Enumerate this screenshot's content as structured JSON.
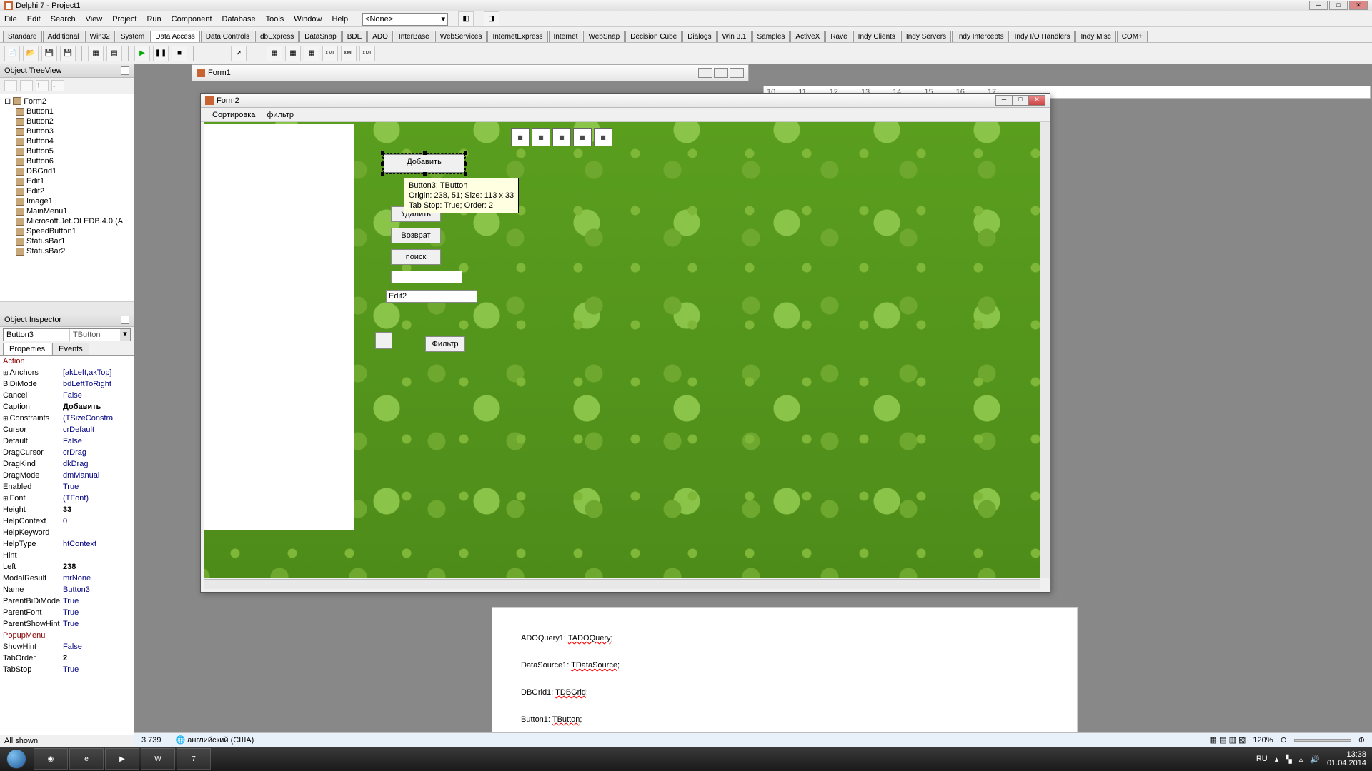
{
  "window_title": "Delphi 7 - Project1",
  "menu": [
    "File",
    "Edit",
    "Search",
    "View",
    "Project",
    "Run",
    "Component",
    "Database",
    "Tools",
    "Window",
    "Help"
  ],
  "menu_combo": "<None>",
  "palette_tabs": [
    "Standard",
    "Additional",
    "Win32",
    "System",
    "Data Access",
    "Data Controls",
    "dbExpress",
    "DataSnap",
    "BDE",
    "ADO",
    "InterBase",
    "WebServices",
    "InternetExpress",
    "Internet",
    "WebSnap",
    "Decision Cube",
    "Dialogs",
    "Win 3.1",
    "Samples",
    "ActiveX",
    "Rave",
    "Indy Clients",
    "Indy Servers",
    "Indy Intercepts",
    "Indy I/O Handlers",
    "Indy Misc",
    "COM+"
  ],
  "active_palette_tab": "Data Access",
  "tree_title": "Object TreeView",
  "tree_root": "Form2",
  "tree_nodes": [
    "Button1",
    "Button2",
    "Button3",
    "Button4",
    "Button5",
    "Button6",
    "DBGrid1",
    "Edit1",
    "Edit2",
    "Image1",
    "MainMenu1",
    "Microsoft.Jet.OLEDB.4.0 (A",
    "SpeedButton1",
    "StatusBar1",
    "StatusBar2"
  ],
  "inspector_title": "Object Inspector",
  "inspector_obj_name": "Button3",
  "inspector_obj_type": "TButton",
  "inspector_tabs": [
    "Properties",
    "Events"
  ],
  "props": [
    {
      "n": "Action",
      "v": "",
      "c": "r"
    },
    {
      "n": "Anchors",
      "v": "[akLeft,akTop]",
      "c": "b",
      "e": true
    },
    {
      "n": "BiDiMode",
      "v": "bdLeftToRight",
      "c": "b"
    },
    {
      "n": "Cancel",
      "v": "False",
      "c": "b"
    },
    {
      "n": "Caption",
      "v": "Добавить",
      "c": "k",
      "bold": true
    },
    {
      "n": "Constraints",
      "v": "(TSizeConstra",
      "c": "b",
      "e": true
    },
    {
      "n": "Cursor",
      "v": "crDefault",
      "c": "b"
    },
    {
      "n": "Default",
      "v": "False",
      "c": "b"
    },
    {
      "n": "DragCursor",
      "v": "crDrag",
      "c": "b"
    },
    {
      "n": "DragKind",
      "v": "dkDrag",
      "c": "b"
    },
    {
      "n": "DragMode",
      "v": "dmManual",
      "c": "b"
    },
    {
      "n": "Enabled",
      "v": "True",
      "c": "b"
    },
    {
      "n": "Font",
      "v": "(TFont)",
      "c": "b",
      "e": true
    },
    {
      "n": "Height",
      "v": "33",
      "c": "k",
      "bold": true
    },
    {
      "n": "HelpContext",
      "v": "0",
      "c": "b"
    },
    {
      "n": "HelpKeyword",
      "v": "",
      "c": "b"
    },
    {
      "n": "HelpType",
      "v": "htContext",
      "c": "b"
    },
    {
      "n": "Hint",
      "v": "",
      "c": "b"
    },
    {
      "n": "Left",
      "v": "238",
      "c": "k",
      "bold": true
    },
    {
      "n": "ModalResult",
      "v": "mrNone",
      "c": "b"
    },
    {
      "n": "Name",
      "v": "Button3",
      "c": "b"
    },
    {
      "n": "ParentBiDiMode",
      "v": "True",
      "c": "b"
    },
    {
      "n": "ParentFont",
      "v": "True",
      "c": "b"
    },
    {
      "n": "ParentShowHint",
      "v": "True",
      "c": "b"
    },
    {
      "n": "PopupMenu",
      "v": "",
      "c": "r"
    },
    {
      "n": "ShowHint",
      "v": "False",
      "c": "b"
    },
    {
      "n": "TabOrder",
      "v": "2",
      "c": "k",
      "bold": true
    },
    {
      "n": "TabStop",
      "v": "True",
      "c": "b"
    }
  ],
  "inspector_status": "All shown",
  "form1_title": "Form1",
  "form2_title": "Form2",
  "form2_menu": [
    "Сортировка",
    "фильтр"
  ],
  "buttons": {
    "add": "Добавить",
    "delete": "Удалить",
    "return": "Возврат",
    "search": "поиск",
    "filter": "Фильтр"
  },
  "edit2_text": "Edit2",
  "tooltip_lines": [
    "Button3: TButton",
    "Origin: 238, 51; Size: 113 x 33",
    "Tab Stop: True; Order: 2"
  ],
  "doc_lines": [
    {
      "a": "ADOQuery1: ",
      "b": "TADOQuery",
      ";": ";"
    },
    {
      "a": "DataSource1: ",
      "b": "TDataSource",
      ";": ";"
    },
    {
      "a": "DBGrid1: ",
      "b": "TDBGrid",
      ";": ";"
    },
    {
      "a": "Button1: ",
      "b": "TButton",
      ";": ";"
    }
  ],
  "ruler_marks": [
    "10",
    "11",
    "12",
    "13",
    "14",
    "15",
    "16",
    "17"
  ],
  "word_status": {
    "words": "3 739",
    "lang": "английский (США)",
    "zoom": "120%"
  },
  "tray": {
    "lang": "RU",
    "time": "13:38",
    "date": "01.04.2014"
  }
}
